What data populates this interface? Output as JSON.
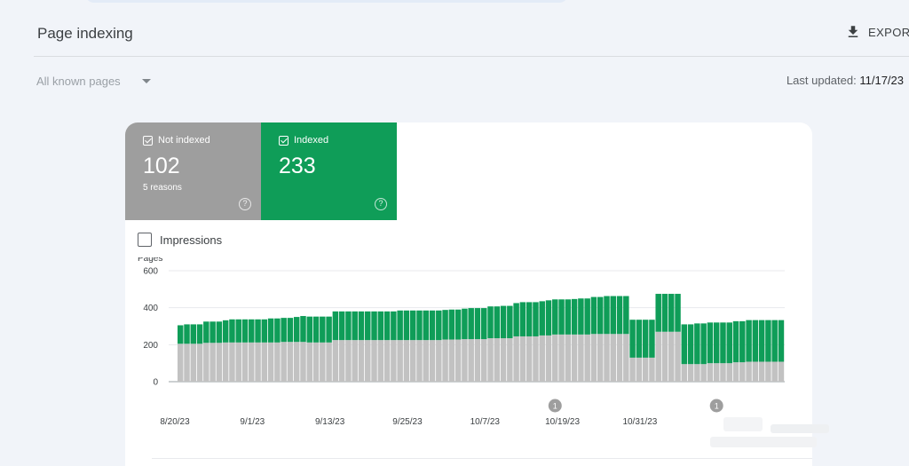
{
  "header": {
    "title": "Page indexing",
    "export_label": "EXPORT",
    "export_icon": "download-icon"
  },
  "filter": {
    "selected": "All known pages",
    "icon": "caret-down-icon"
  },
  "last_updated": {
    "label": "Last updated:",
    "value": "11/17/23"
  },
  "tiles": {
    "not_indexed": {
      "label": "Not indexed",
      "value": "102",
      "sub": "5 reasons",
      "color": "#9e9e9e"
    },
    "indexed": {
      "label": "Indexed",
      "value": "233",
      "color": "#0f9d58"
    }
  },
  "impressions": {
    "label": "Impressions",
    "checked": false
  },
  "chart_data": {
    "type": "bar",
    "stacked": true,
    "ylabel": "Pages",
    "ylim": [
      0,
      600
    ],
    "yticks": [
      0,
      200,
      400,
      600
    ],
    "grid": true,
    "xtick_labels": [
      "8/20/23",
      "9/1/23",
      "9/13/23",
      "9/25/23",
      "10/7/23",
      "10/19/23",
      "10/31/23"
    ],
    "xtick_indices": [
      0,
      12,
      24,
      36,
      48,
      60,
      72
    ],
    "annotations": [
      {
        "index": 58,
        "text": "1"
      },
      {
        "index": 83,
        "text": "1"
      }
    ],
    "series": [
      {
        "name": "Not indexed",
        "color": "#c2c2c2",
        "values": [
          205,
          205,
          205,
          205,
          210,
          210,
          210,
          212,
          212,
          212,
          212,
          212,
          212,
          212,
          212,
          212,
          215,
          215,
          215,
          215,
          212,
          212,
          212,
          212,
          225,
          225,
          225,
          225,
          225,
          225,
          225,
          225,
          225,
          225,
          225,
          225,
          225,
          225,
          225,
          225,
          225,
          228,
          228,
          228,
          230,
          230,
          230,
          230,
          235,
          235,
          235,
          235,
          245,
          245,
          245,
          245,
          250,
          250,
          255,
          255,
          255,
          255,
          255,
          255,
          258,
          258,
          258,
          258,
          258,
          258,
          130,
          130,
          130,
          130,
          270,
          270,
          270,
          270,
          95,
          95,
          95,
          95,
          100,
          100,
          100,
          100,
          105,
          105,
          108,
          108,
          108,
          108,
          108,
          108
        ]
      },
      {
        "name": "Indexed",
        "color": "#0f9d58",
        "values": [
          100,
          105,
          105,
          105,
          115,
          115,
          115,
          120,
          125,
          125,
          125,
          125,
          125,
          125,
          130,
          130,
          130,
          130,
          135,
          140,
          140,
          140,
          140,
          140,
          155,
          155,
          155,
          155,
          155,
          155,
          155,
          155,
          155,
          155,
          160,
          160,
          160,
          160,
          160,
          160,
          160,
          160,
          162,
          162,
          165,
          168,
          168,
          168,
          172,
          172,
          175,
          175,
          180,
          185,
          185,
          185,
          185,
          190,
          190,
          190,
          190,
          192,
          195,
          195,
          200,
          200,
          205,
          205,
          205,
          205,
          205,
          205,
          205,
          205,
          205,
          205,
          205,
          205,
          215,
          215,
          220,
          220,
          220,
          220,
          220,
          220,
          222,
          222,
          225,
          225,
          225,
          225,
          225,
          225
        ]
      }
    ]
  }
}
